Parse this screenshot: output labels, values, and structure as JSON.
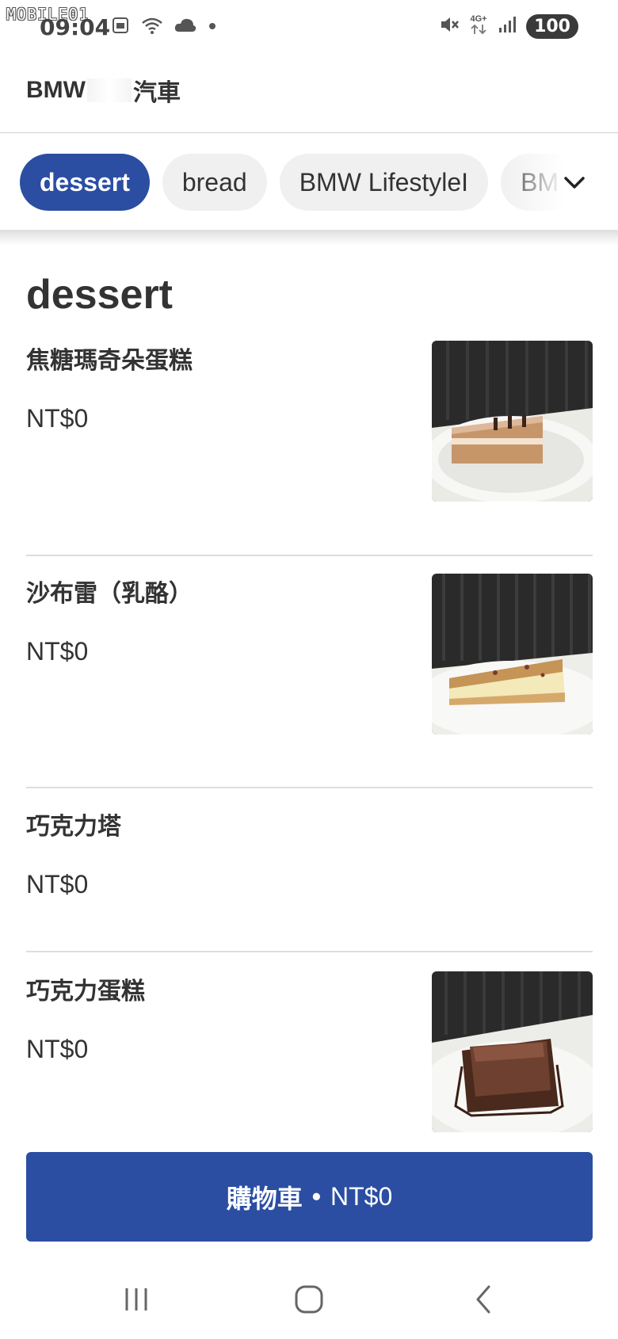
{
  "status_bar": {
    "watermark": "MOBILE01",
    "time": "09:04",
    "network": "4G+",
    "battery": "100",
    "icons": [
      "screenshot-icon",
      "wifi-icon",
      "cloud-icon",
      "dot-icon",
      "mute-icon",
      "network-arrows-icon",
      "signal-icon",
      "battery-icon"
    ]
  },
  "header": {
    "title_prefix": "BMW",
    "title_suffix": "汽車"
  },
  "categories": {
    "items": [
      {
        "label": "dessert",
        "active": true
      },
      {
        "label": "bread",
        "active": false
      },
      {
        "label": "BMW LifestyleI",
        "active": false
      },
      {
        "label": "BM",
        "active": false
      }
    ],
    "more_icon": "chevron-down-icon"
  },
  "section": {
    "title": "dessert"
  },
  "items": [
    {
      "name": "焦糖瑪奇朵蛋糕",
      "price": "NT$0",
      "has_image": true,
      "image": "cake-slice-photo"
    },
    {
      "name": "沙布雷（乳酪）",
      "price": "NT$0",
      "has_image": true,
      "image": "cheesecake-photo"
    },
    {
      "name": "巧克力塔",
      "price": "NT$0",
      "has_image": false
    },
    {
      "name": "巧克力蛋糕",
      "price": "NT$0",
      "has_image": true,
      "image": "brownie-photo"
    }
  ],
  "cart": {
    "label": "購物車",
    "separator": "•",
    "total": "NT$0"
  },
  "nav": {
    "icons": [
      "recent-apps-icon",
      "home-icon",
      "back-icon"
    ]
  },
  "colors": {
    "accent": "#2b4ea2",
    "chip_bg": "#f0f0f0",
    "text": "#333333"
  }
}
